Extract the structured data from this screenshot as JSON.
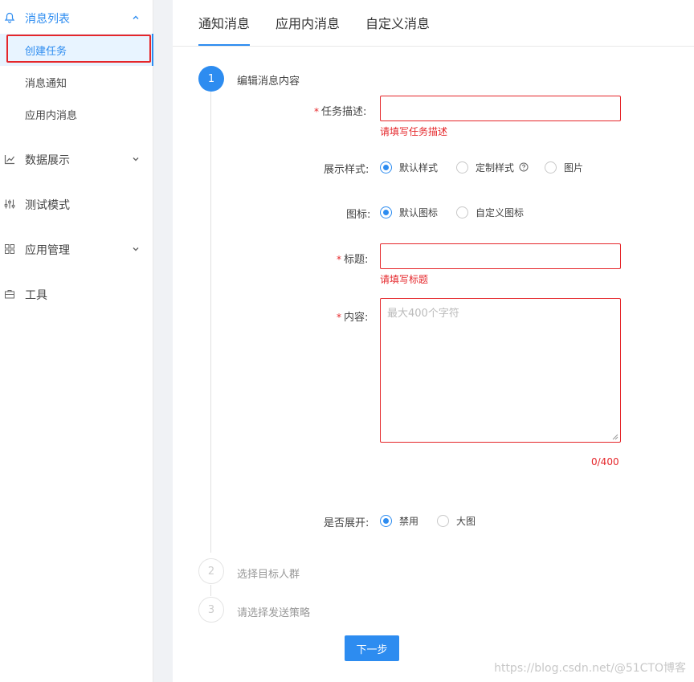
{
  "sidebar": {
    "groups": [
      {
        "label": "消息列表",
        "icon": "bell-icon",
        "expanded": true
      },
      {
        "label": "数据展示",
        "icon": "chart-icon"
      },
      {
        "label": "测试模式",
        "icon": "sliders-icon"
      },
      {
        "label": "应用管理",
        "icon": "grid-icon"
      },
      {
        "label": "工具",
        "icon": "toolbox-icon"
      }
    ],
    "sub_items": [
      {
        "label": "创建任务",
        "selected": true
      },
      {
        "label": "消息通知"
      },
      {
        "label": "应用内消息"
      }
    ]
  },
  "tabs": [
    {
      "label": "通知消息",
      "active": true
    },
    {
      "label": "应用内消息"
    },
    {
      "label": "自定义消息"
    }
  ],
  "steps": [
    {
      "number": "1",
      "title": "编辑消息内容",
      "status": "active"
    },
    {
      "number": "2",
      "title": "选择目标人群",
      "status": "wait"
    },
    {
      "number": "3",
      "title": "请选择发送策略",
      "status": "wait"
    }
  ],
  "form": {
    "task_desc": {
      "label": "任务描述:",
      "required_mark": "*",
      "value": "",
      "error": "请填写任务描述"
    },
    "display_style": {
      "label": "展示样式:",
      "options": [
        "默认样式",
        "定制样式",
        "图片"
      ],
      "selected": "默认样式"
    },
    "icon": {
      "label": "图标:",
      "options": [
        "默认图标",
        "自定义图标"
      ],
      "selected": "默认图标"
    },
    "title": {
      "label": "标题:",
      "required_mark": "*",
      "value": "",
      "error": "请填写标题"
    },
    "content": {
      "label": "内容:",
      "required_mark": "*",
      "placeholder": "最大400个字符",
      "counter": "0/400"
    },
    "expand": {
      "label": "是否展开:",
      "options": [
        "禁用",
        "大图"
      ],
      "selected": "禁用"
    }
  },
  "next_button": "下一步",
  "watermark": "https://blog.csdn.net/@51CTO博客",
  "colors": {
    "accent": "#2d8cf0",
    "error": "#e5262a"
  }
}
